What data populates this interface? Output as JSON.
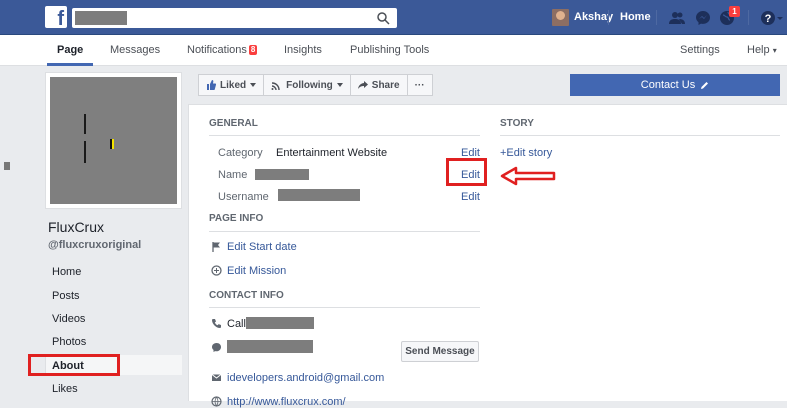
{
  "topbar": {
    "logo_letter": "f",
    "user_name": "Akshay",
    "home_label": "Home",
    "notification_count": "1"
  },
  "pagenav": {
    "tabs": [
      {
        "label": "Page"
      },
      {
        "label": "Messages"
      },
      {
        "label": "Notifications"
      },
      {
        "label": "Insights"
      },
      {
        "label": "Publishing Tools"
      }
    ],
    "notifications_badge": "8",
    "settings_label": "Settings",
    "help_label": "Help",
    "help_caret": "▾"
  },
  "profile": {
    "name": "FluxCrux",
    "handle": "@fluxcruxoriginal"
  },
  "sidebar": {
    "items": [
      {
        "label": "Home"
      },
      {
        "label": "Posts"
      },
      {
        "label": "Videos"
      },
      {
        "label": "Photos"
      },
      {
        "label": "About"
      },
      {
        "label": "Likes"
      }
    ]
  },
  "actions": {
    "liked": "Liked",
    "following": "Following",
    "share": "Share",
    "more": "···",
    "contact_us": "Contact Us"
  },
  "general": {
    "heading": "GENERAL",
    "category_label": "Category",
    "category_value": "Entertainment Website",
    "name_label": "Name",
    "username_label": "Username",
    "edit": "Edit"
  },
  "page_info": {
    "heading": "PAGE INFO",
    "edit_start_date": "Edit Start date",
    "edit_mission": "Edit Mission"
  },
  "contact_info": {
    "heading": "CONTACT INFO",
    "call_prefix": "Call",
    "send_message": "Send Message",
    "email": "idevelopers.android@gmail.com",
    "website": "http://www.fluxcrux.com/"
  },
  "story": {
    "heading": "STORY",
    "edit_story": "+Edit story"
  },
  "colors": {
    "fb_blue": "#3b5998",
    "accent_blue": "#4267b2",
    "annotation_red": "#e02020"
  }
}
